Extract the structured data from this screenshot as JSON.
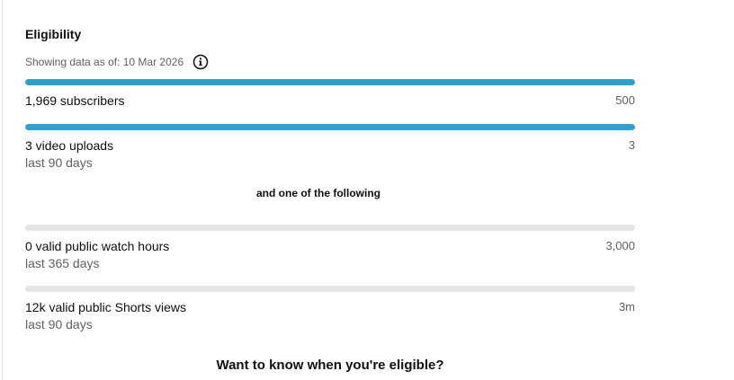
{
  "section": {
    "title": "Eligibility",
    "as_of_label": "Showing data as of: 10 Mar 2026"
  },
  "requirements": [
    {
      "label": "1,969 subscribers",
      "target": "500",
      "sub": "",
      "progress": 1.0
    },
    {
      "label": "3 video uploads",
      "target": "3",
      "sub": "last 90 days",
      "progress": 1.0
    }
  ],
  "divider_text": "and one of the following",
  "alternatives": [
    {
      "label": "0 valid public watch hours",
      "target": "3,000",
      "sub": "last 365 days",
      "progress": 0.0
    },
    {
      "label": "12k valid public Shorts views",
      "target": "3m",
      "sub": "last 90 days",
      "progress": 0.0
    }
  ],
  "cta_text": "Want to know when you're eligible?",
  "colors": {
    "progress_fill": "#2f9fce",
    "progress_track": "#e5e5e5"
  },
  "icons": {
    "info": "info-icon"
  }
}
